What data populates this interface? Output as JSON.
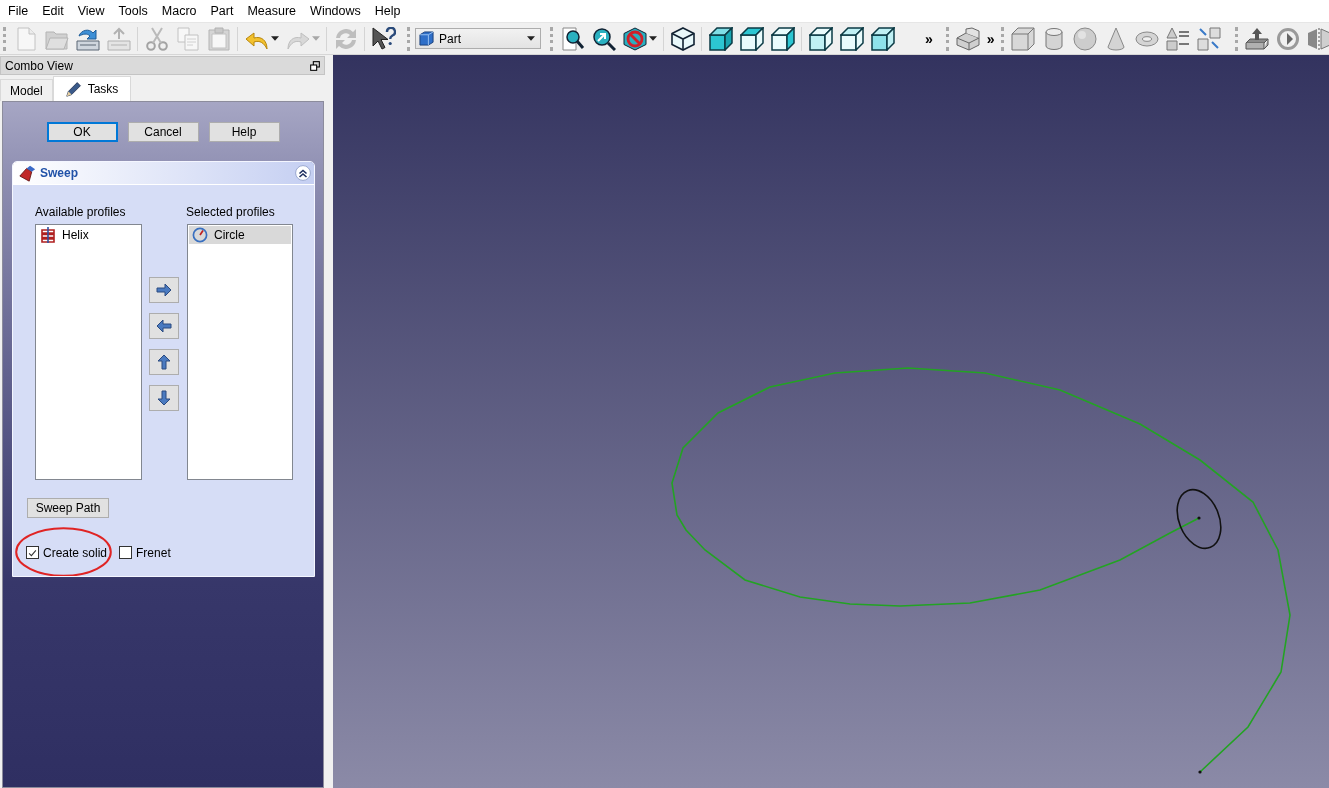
{
  "menu": [
    "File",
    "Edit",
    "View",
    "Tools",
    "Macro",
    "Part",
    "Measure",
    "Windows",
    "Help"
  ],
  "toolbar": {
    "buttons": [
      {
        "disabled": true
      },
      {
        "disabled": true
      },
      {
        "disabled": false
      },
      {
        "disabled": true
      },
      {
        "disabled": true
      },
      {
        "disabled": true
      },
      {
        "disabled": true
      },
      {
        "disabled": false
      },
      {
        "disabled": true
      },
      {
        "disabled": true
      },
      {
        "disabled": false
      }
    ],
    "workbench": "Part",
    "overflow": [
      "»",
      "»"
    ]
  },
  "combo_view": {
    "title": "Combo View",
    "tabs": [
      {
        "label": "Model",
        "selected": false
      },
      {
        "label": "Tasks",
        "selected": true
      }
    ],
    "dialog_buttons": [
      {
        "label": "OK",
        "focused": true
      },
      {
        "label": "Cancel",
        "focused": false
      },
      {
        "label": "Help",
        "focused": false
      }
    ],
    "sweep": {
      "title": "Sweep",
      "expanded": true,
      "available_profiles": {
        "label": "Available profiles",
        "items": [
          {
            "label": "Helix",
            "selected": false
          }
        ]
      },
      "selected_profiles": {
        "label": "Selected profiles",
        "items": [
          {
            "label": "Circle",
            "selected": true
          }
        ]
      },
      "path_button": "Sweep Path",
      "options": [
        {
          "label": "Create solid",
          "checked": true,
          "highlighted": true
        },
        {
          "label": "Frenet",
          "checked": false,
          "highlighted": false
        }
      ]
    }
  }
}
